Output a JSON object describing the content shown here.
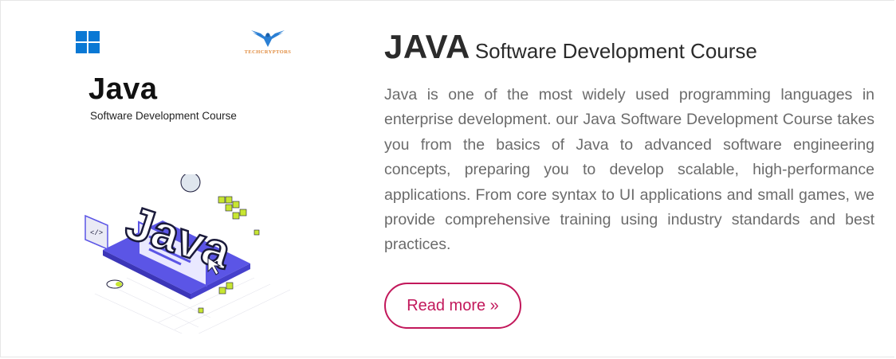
{
  "thumbnail": {
    "logo_text": "TECHCRYPTORS",
    "title": "Java",
    "subtitle": "Software Development Course",
    "illustration_text": "Java",
    "code_tag": "</>"
  },
  "course": {
    "title_main": "JAVA",
    "title_sub": "Software Development Course",
    "description": "Java is one of the most widely used programming languages in enterprise development. our Java Software Development Course takes you from the basics of Java to advanced software engineering concepts, preparing you to develop scalable, high-performance applications. From core syntax to UI applications and small games, we provide comprehensive training using industry standards and best practices.",
    "read_more_label": "Read more »"
  },
  "colors": {
    "accent": "#c2185b",
    "heading": "#2b2b2b",
    "body_text": "#6b6b6b",
    "windows_blue": "#0a78d4",
    "illustration_purple": "#5b55e6",
    "illustration_green": "#c8e632"
  }
}
